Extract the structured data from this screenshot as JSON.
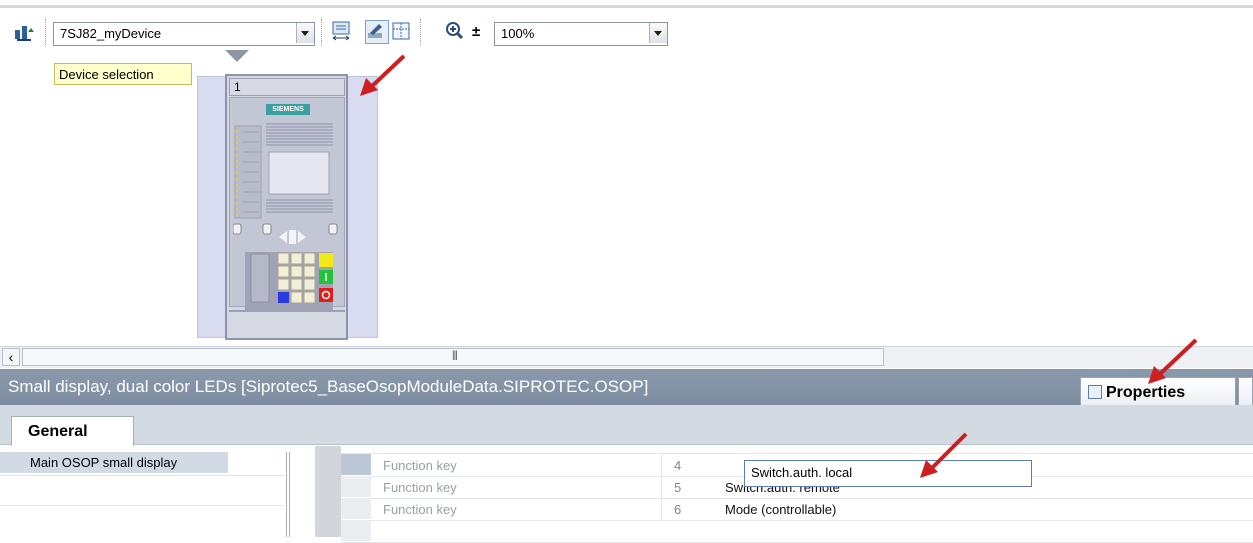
{
  "toolbar": {
    "device_combo_value": "7SJ82_myDevice",
    "zoom_combo_value": "100%",
    "tooltip": "Device selection"
  },
  "device": {
    "slot_number": "1",
    "brand": "SIEMENS"
  },
  "properties_panel": {
    "title": "Small display, dual color LEDs [Siprotec5_BaseOsopModuleData.SIPROTEC.OSOP]",
    "properties_tab": "Properties",
    "general_tab": "General",
    "nav_item": "Main OSOP small display"
  },
  "table": {
    "rows": [
      {
        "type": "Function key",
        "number": "4",
        "function": "Switch.auth. local"
      },
      {
        "type": "Function key",
        "number": "5",
        "function": "Switch.auth. remote"
      },
      {
        "type": "Function key",
        "number": "6",
        "function": "Mode (controllable)"
      }
    ]
  },
  "colors": {
    "title_bar": "#8594a7",
    "annotation_arrow": "#cc1f1f",
    "tooltip_bg": "#ffffcc"
  }
}
